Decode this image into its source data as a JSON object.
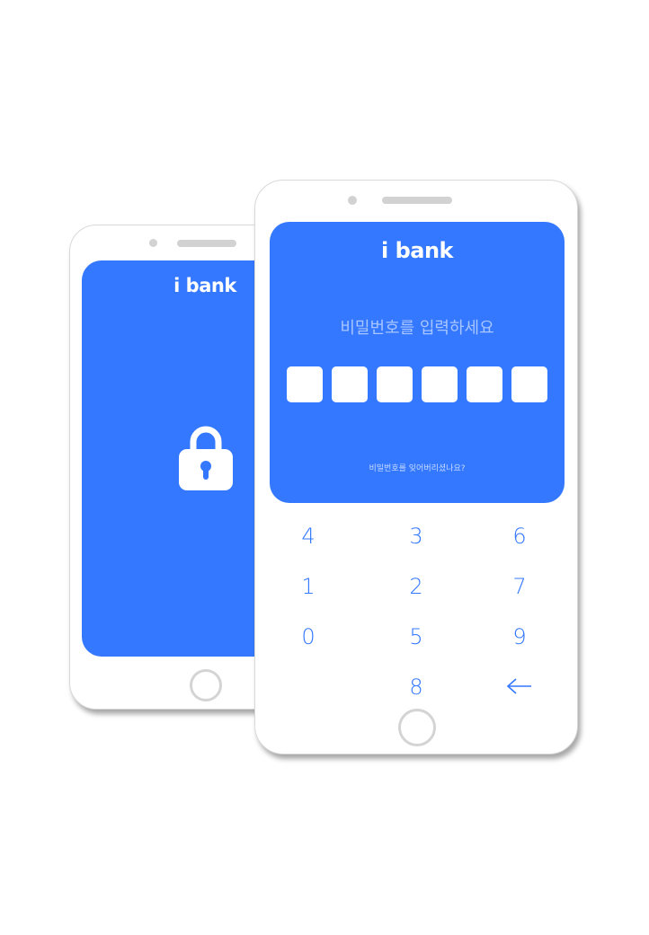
{
  "back_phone": {
    "brand": "i bank",
    "lock_icon": "lock-icon"
  },
  "front_phone": {
    "brand": "i bank",
    "prompt": "비밀번호를 입력하세요",
    "pin_length": 6,
    "forgot_link": "비밀번호를 잊어버리셨나요?",
    "keypad": {
      "row1": [
        "4",
        "3",
        "6"
      ],
      "row2": [
        "1",
        "2",
        "7"
      ],
      "row3": [
        "0",
        "5",
        "9"
      ],
      "row4": [
        "8"
      ],
      "backspace_icon": "arrow-left-icon"
    }
  },
  "colors": {
    "accent": "#3478ff",
    "prompt_text": "#a8c6ff",
    "frame_border": "#d9d9d9",
    "home_ring": "#d4d4d4"
  }
}
